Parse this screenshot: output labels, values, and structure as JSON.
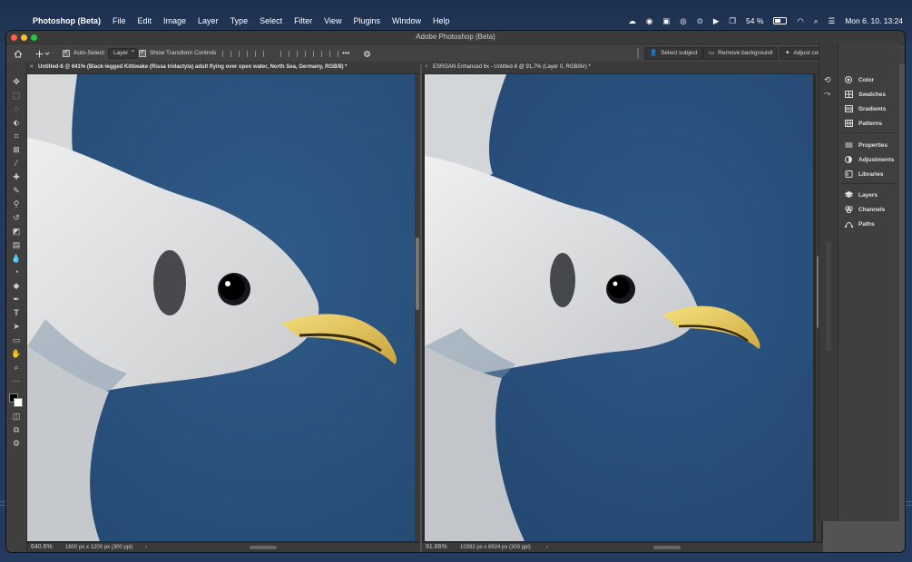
{
  "menubar": {
    "app_name": "Photoshop (Beta)",
    "items": [
      "File",
      "Edit",
      "Image",
      "Layer",
      "Type",
      "Select",
      "Filter",
      "View",
      "Plugins",
      "Window",
      "Help"
    ],
    "battery": "54 %",
    "datetime": "Mon 6. 10.  13:24"
  },
  "window": {
    "title": "Adobe Photoshop (Beta)"
  },
  "options_bar": {
    "auto_select_label": "Auto-Select:",
    "auto_select_value": "Layer",
    "transform_controls_label": "Show Transform Controls",
    "more": "•••",
    "select_subject": "Select subject",
    "remove_background": "Remove background",
    "adjust_colors": "Adjust colors"
  },
  "docs": [
    {
      "tab": "Untitled-8 @ 641% (Black-legged Kittiwake (Rissa tridactyla) adult flying over open water, North Sea, Germany, RGB/8) *",
      "zoom": "640.6%",
      "info": "1800 px x 1200 px (300 ppi)"
    },
    {
      "tab": "ESRGAN Enhanced 6x - Untitled-8 @ 91,7% (Layer 0, RGB/8#) *",
      "zoom": "91.66%",
      "info": "10392 px x 6924 px (300 ppi)"
    }
  ],
  "panels": {
    "group1": [
      "Color",
      "Swatches",
      "Gradients",
      "Patterns"
    ],
    "group2": [
      "Properties",
      "Adjustments",
      "Libraries"
    ],
    "group3": [
      "Layers",
      "Channels",
      "Paths"
    ]
  },
  "colors": {
    "traffic_red": "#ff5f57",
    "traffic_yellow": "#febc2e",
    "traffic_green": "#28c840",
    "water_blue": "#2e5683"
  }
}
